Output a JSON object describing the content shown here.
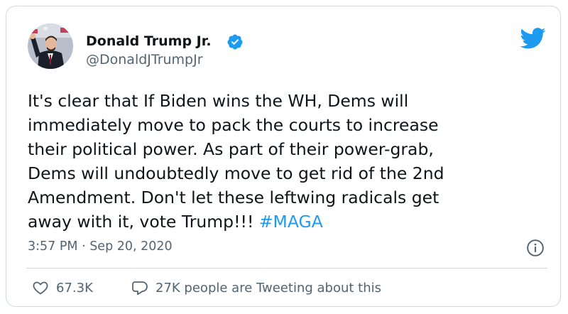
{
  "author": {
    "name": "Donald Trump Jr.",
    "handle": "@DonaldJTrumpJr",
    "verified": true,
    "avatar_icon": "profile-photo"
  },
  "tweet": {
    "lines": [
      "It's clear that If Biden wins the WH, Dems will",
      "immediately move to pack the courts to increase",
      "their political power. As part of their power-grab,",
      "Dems will undoubtedly move to get rid of the 2nd",
      "Amendment. Don't let these leftwing radicals get",
      "away with it, vote Trump!!!"
    ],
    "hashtag": "#MAGA",
    "timestamp": "3:57 PM · Sep 20, 2020"
  },
  "stats": {
    "likes": "67.3K",
    "tweeting": "27K people are Tweeting about this"
  },
  "icons": {
    "brand": "twitter-bird-icon",
    "verified": "verified-badge-icon",
    "info": "info-icon",
    "like": "heart-icon",
    "reply": "speech-bubble-icon"
  },
  "colors": {
    "accent": "#1d9bf0",
    "text": "#0f1419",
    "secondary": "#536471",
    "border": "#cfd9de"
  }
}
